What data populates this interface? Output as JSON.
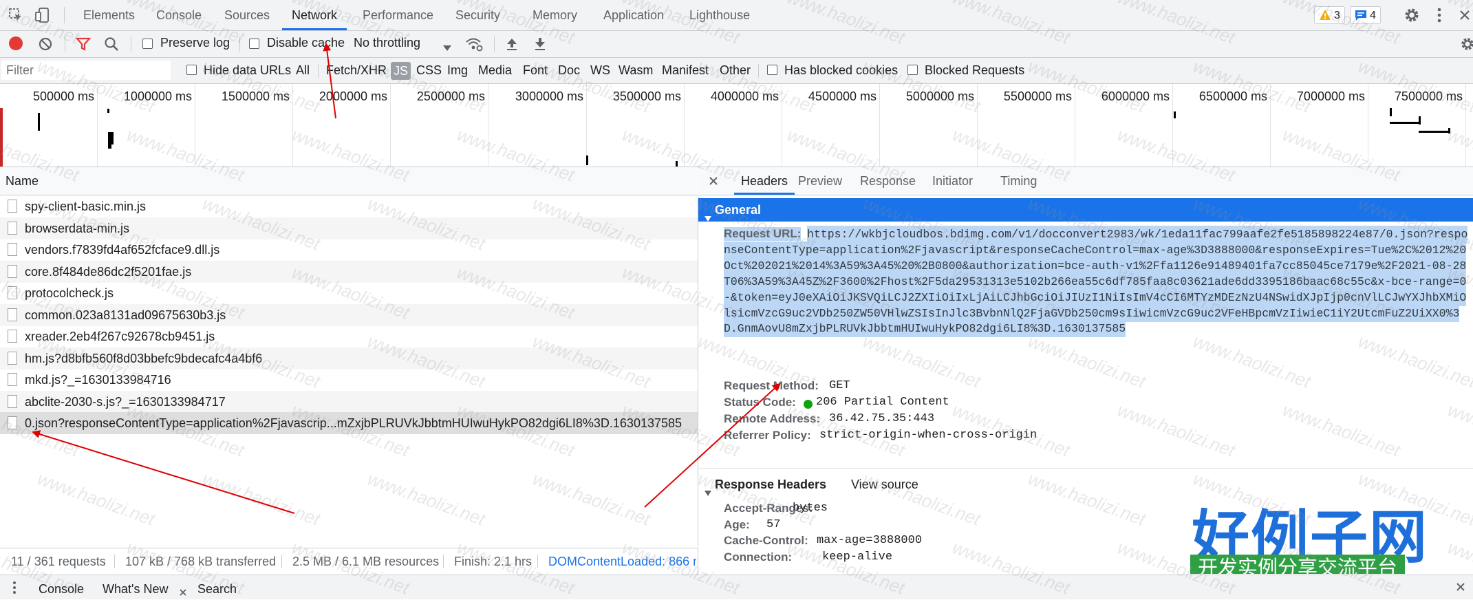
{
  "tabs": [
    "Elements",
    "Console",
    "Sources",
    "Network",
    "Performance",
    "Security",
    "Memory",
    "Application",
    "Lighthouse"
  ],
  "active_tab": "Network",
  "badges": {
    "warnings": "3",
    "messages": "4"
  },
  "toolbar": {
    "preserve_log": "Preserve log",
    "disable_cache": "Disable cache",
    "throttling": "No throttling"
  },
  "filter": {
    "placeholder": "Filter",
    "hide_data_urls": "Hide data URLs",
    "types": [
      "All",
      "Fetch/XHR",
      "JS",
      "CSS",
      "Img",
      "Media",
      "Font",
      "Doc",
      "WS",
      "Wasm",
      "Manifest",
      "Other"
    ],
    "selected_type": "JS",
    "has_blocked_cookies": "Has blocked cookies",
    "blocked_requests": "Blocked Requests"
  },
  "overview_ticks": [
    "500000 ms",
    "1000000 ms",
    "1500000 ms",
    "2000000 ms",
    "2500000 ms",
    "3000000 ms",
    "3500000 ms",
    "4000000 ms",
    "4500000 ms",
    "5000000 ms",
    "5500000 ms",
    "6000000 ms",
    "6500000 ms",
    "7000000 ms",
    "7500000 ms"
  ],
  "list": {
    "column_name": "Name",
    "requests": [
      "spy-client-basic.min.js",
      "browserdata-min.js",
      "vendors.f7839fd4af652fcface9.dll.js",
      "core.8f484de86dc2f5201fae.js",
      "protocolcheck.js",
      "common.023a8131ad09675630b3.js",
      "xreader.2eb4f267c92678cb9451.js",
      "hm.js?d8bfb560f8d03bbefc9bdecafc4a4bf6",
      "mkd.js?_=1630133984716",
      "abclite-2030-s.js?_=1630133984717",
      "0.json?responseContentType=application%2Fjavascrip...mZxjbPLRUVkJbbtmHUIwuHykPO82dgi6LI8%3D.1630137585"
    ],
    "selected_index": 10
  },
  "status": {
    "requests": "11 / 361 requests",
    "transferred": "107 kB / 768 kB transferred",
    "resources": "2.5 MB / 6.1 MB resources",
    "finish": "Finish: 2.1 hrs",
    "dom_loaded": "DOMContentLoaded: 866 r"
  },
  "detail_tabs": [
    "Headers",
    "Preview",
    "Response",
    "Initiator",
    "Timing"
  ],
  "general": {
    "title": "General",
    "request_url_label": "Request URL:",
    "request_url_lines": [
      "https://wkbjcloudbos.bdimg.com/v1/docconvert2983/wk/1eda11fac799aafe2fe5185898224e87/0.json?respo",
      "nseContentType=application%2Fjavascript&responseCacheControl=max-age%3D3888000&responseExpires=Tue%2C%2012%20",
      "Oct%202021%2014%3A59%3A45%20%2B0800&authorization=bce-auth-v1%2Ffa1126e91489401fa7cc85045ce7179e%2F2021-08-28",
      "T06%3A59%3A45Z%2F3600%2Fhost%2F5da29531313e5102b266ea55c6df785faa8c03621ade6dd3395186baac68c55c&x-bce-range=0",
      "-&token=eyJ0eXAiOiJKSVQiLCJ2ZXIiOiIxLjAiLCJhbGciOiJIUzI1NiIsImV4cCI6MTYzMDEzNzU4NSwidXJpIjp0cnVlLCJwYXJhbXMiO",
      "lsicmVzcG9uc2VDb250ZW50VHlwZSIsInJlc3BvbnNlQ2FjaGVDb250cm9sIiwicmVzcG9uc2VFeHBpcmVzIiwieC1iY2UtcmFuZ2UiXX0%3",
      "D.GnmAovU8mZxjbPLRUVkJbbtmHUIwuHykPO82dgi6LI8%3D.1630137585"
    ],
    "request_method_label": "Request Method:",
    "request_method": "GET",
    "status_code_label": "Status Code:",
    "status_code": "206 Partial Content",
    "status_color": "#0ca40c",
    "remote_address_label": "Remote Address:",
    "remote_address": "36.42.75.35:443",
    "referrer_policy_label": "Referrer Policy:",
    "referrer_policy": "strict-origin-when-cross-origin"
  },
  "response_headers": {
    "title": "Response Headers",
    "view_source": "View source",
    "items": [
      {
        "name": "Accept-Ranges:",
        "value": "bytes"
      },
      {
        "name": "Age:",
        "value": "57"
      },
      {
        "name": "Cache-Control:",
        "value": "max-age=3888000"
      },
      {
        "name": "Connection:",
        "value": "keep-alive"
      }
    ]
  },
  "drawer": {
    "tabs": [
      "Console",
      "What's New",
      "Search"
    ]
  },
  "logo": {
    "title": "好例子网",
    "subtitle": "开发实例分享交流平台"
  },
  "watermark": "www.haolizi.net",
  "colors": {
    "accent": "#1a73e8",
    "general_header": "#1a73e8",
    "selection": "#bcd7f5",
    "record": "#e53935",
    "annotation": "#e00000"
  }
}
